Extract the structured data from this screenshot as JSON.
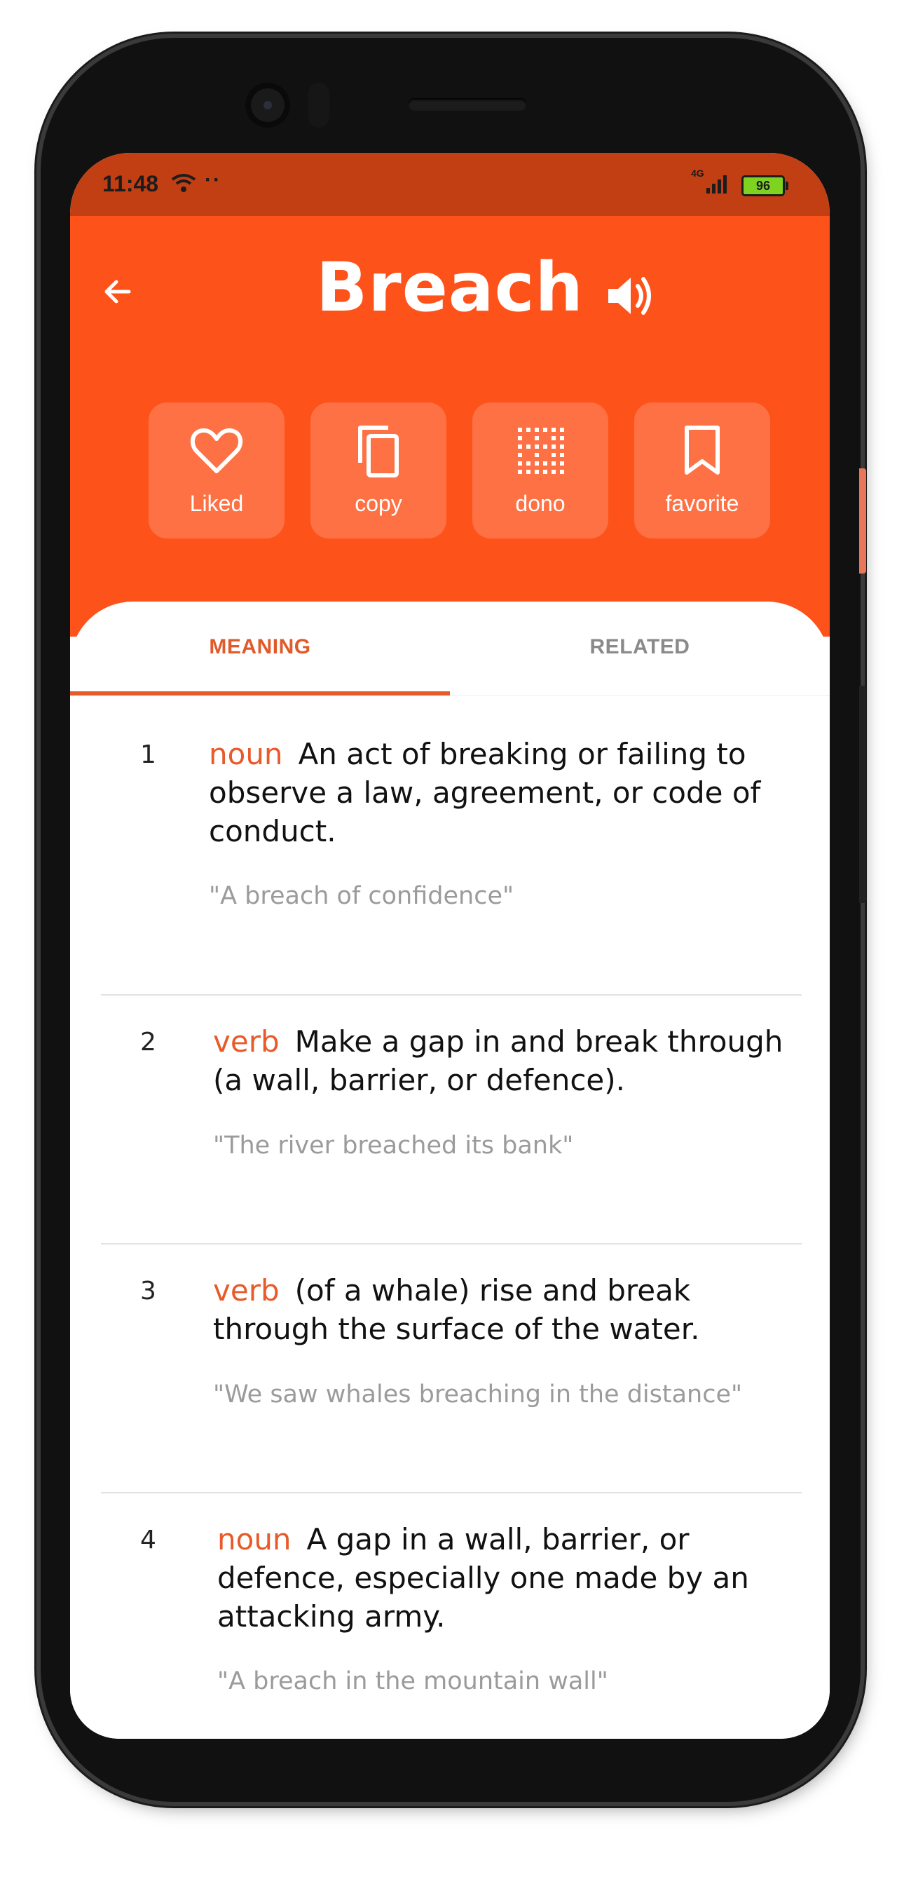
{
  "status_bar": {
    "time": "11:48",
    "dots": "··",
    "network": "4G",
    "battery": "96"
  },
  "header": {
    "word": "Breach",
    "back_icon": "arrow-left-icon",
    "speaker_icon": "volume-up-icon",
    "accent_color": "#fe521b"
  },
  "actions": [
    {
      "label": "Liked",
      "icon": "heart-outline-icon"
    },
    {
      "label": "copy",
      "icon": "copy-icon"
    },
    {
      "label": "dono",
      "icon": "dotted-grid-icon"
    },
    {
      "label": "favorite",
      "icon": "bookmark-icon"
    }
  ],
  "tabs": {
    "meaning": "MEANING",
    "related": "RELATED",
    "active": "MEANING"
  },
  "definitions": [
    {
      "num": "1",
      "pos": "noun",
      "text": "An act of breaking or failing to observe a law, agreement, or code of conduct.",
      "example": "\"A breach of confidence\""
    },
    {
      "num": "2",
      "pos": "verb",
      "text": "Make a gap in and break through (a wall, barrier, or defence).",
      "example": "\"The river breached its bank\""
    },
    {
      "num": "3",
      "pos": "verb",
      "text": "(of a whale) rise and break through the surface of the water.",
      "example": "\"We saw whales breaching in the distance\""
    },
    {
      "num": "4",
      "pos": "noun",
      "text": "A gap in a wall, barrier, or defence, especially one made by an attacking army.",
      "example": "\"A breach in the mountain wall\""
    }
  ]
}
